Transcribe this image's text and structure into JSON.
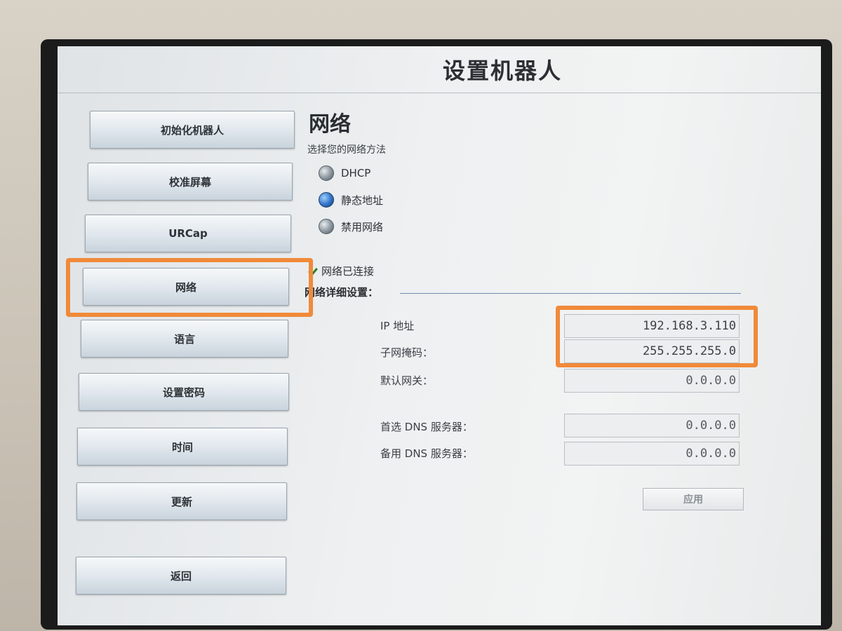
{
  "header": {
    "title": "设置机器人"
  },
  "sidebar": {
    "items": [
      {
        "label": "初始化机器人"
      },
      {
        "label": "校准屏幕"
      },
      {
        "label": "URCap"
      },
      {
        "label": "网络"
      },
      {
        "label": "语言"
      },
      {
        "label": "设置密码"
      },
      {
        "label": "时间"
      },
      {
        "label": "更新"
      }
    ],
    "back_label": "返回"
  },
  "network": {
    "title": "网络",
    "method_prompt": "选择您的网络方法",
    "options": [
      {
        "label": "DHCP",
        "selected": false
      },
      {
        "label": "静态地址",
        "selected": true
      },
      {
        "label": "禁用网络",
        "selected": false
      }
    ],
    "status": "网络已连接",
    "details_header": "网络详细设置：",
    "fields": [
      {
        "label": "IP 地址",
        "value": "192.168.3.110"
      },
      {
        "label": "子网掩码：",
        "value": "255.255.255.0"
      },
      {
        "label": "默认网关：",
        "value": "0.0.0.0"
      },
      {
        "label": "首选 DNS 服务器：",
        "value": "0.0.0.0"
      },
      {
        "label": "备用 DNS 服务器：",
        "value": "0.0.0.0"
      }
    ],
    "apply_label": "应用"
  },
  "colors": {
    "highlight": "#f08a3a",
    "selected_radio": "#2f72c6"
  }
}
